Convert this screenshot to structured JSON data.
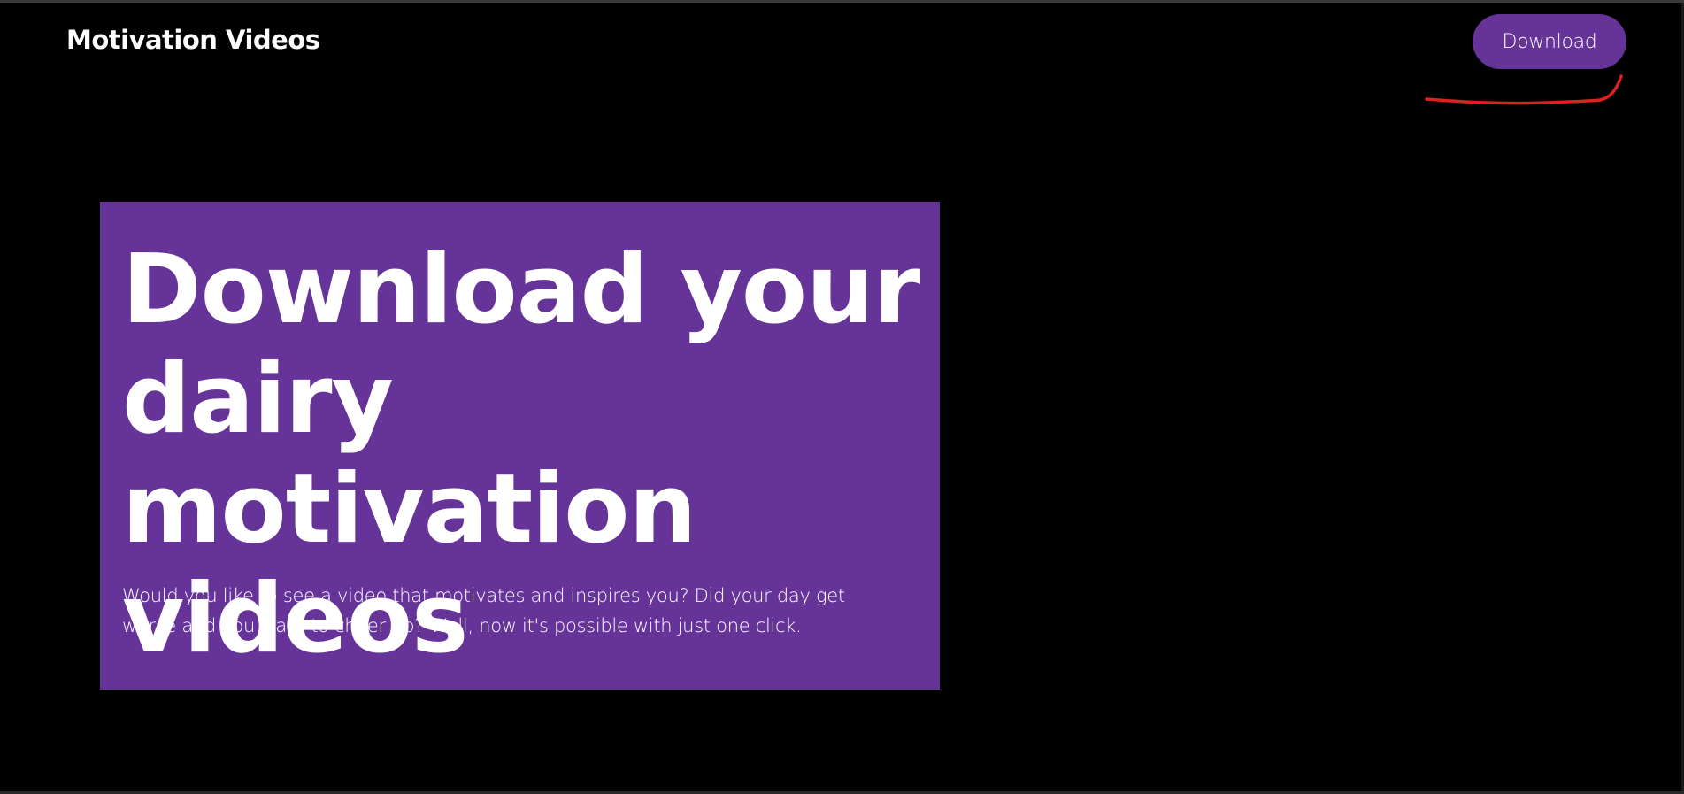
{
  "header": {
    "brand": "Motivation Videos",
    "download_label": "Download"
  },
  "hero": {
    "title": "Download your dairy motivation videos",
    "description": "Would you like to see a video that motivates and inspires you? Did your day get worse and you want to cheer up? Well, now it's possible with just one click."
  },
  "colors": {
    "background": "#000000",
    "accent": "#663399",
    "text": "#ffffff",
    "annotation": "#e02020"
  }
}
